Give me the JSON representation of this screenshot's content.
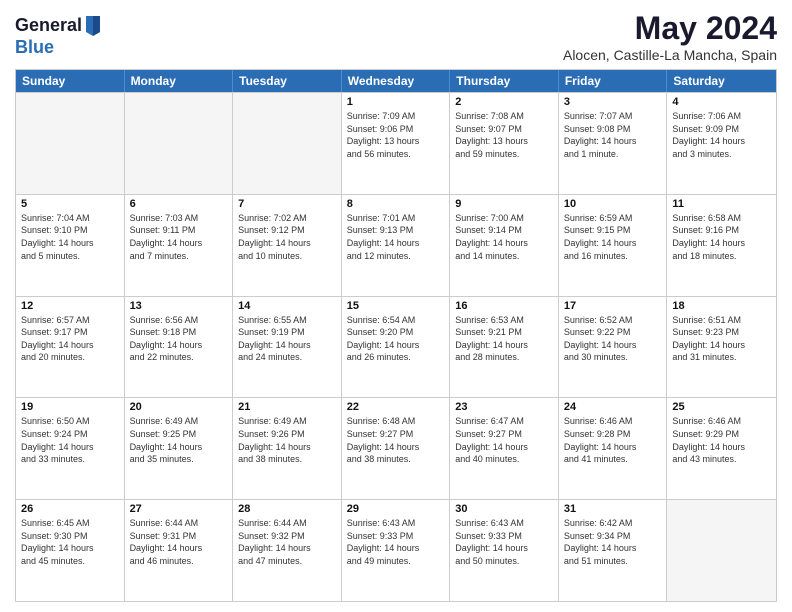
{
  "header": {
    "logo_general": "General",
    "logo_blue": "Blue",
    "title": "May 2024",
    "subtitle": "Alocen, Castille-La Mancha, Spain"
  },
  "days_of_week": [
    "Sunday",
    "Monday",
    "Tuesday",
    "Wednesday",
    "Thursday",
    "Friday",
    "Saturday"
  ],
  "weeks": [
    [
      {
        "day": "",
        "info": ""
      },
      {
        "day": "",
        "info": ""
      },
      {
        "day": "",
        "info": ""
      },
      {
        "day": "1",
        "info": "Sunrise: 7:09 AM\nSunset: 9:06 PM\nDaylight: 13 hours\nand 56 minutes."
      },
      {
        "day": "2",
        "info": "Sunrise: 7:08 AM\nSunset: 9:07 PM\nDaylight: 13 hours\nand 59 minutes."
      },
      {
        "day": "3",
        "info": "Sunrise: 7:07 AM\nSunset: 9:08 PM\nDaylight: 14 hours\nand 1 minute."
      },
      {
        "day": "4",
        "info": "Sunrise: 7:06 AM\nSunset: 9:09 PM\nDaylight: 14 hours\nand 3 minutes."
      }
    ],
    [
      {
        "day": "5",
        "info": "Sunrise: 7:04 AM\nSunset: 9:10 PM\nDaylight: 14 hours\nand 5 minutes."
      },
      {
        "day": "6",
        "info": "Sunrise: 7:03 AM\nSunset: 9:11 PM\nDaylight: 14 hours\nand 7 minutes."
      },
      {
        "day": "7",
        "info": "Sunrise: 7:02 AM\nSunset: 9:12 PM\nDaylight: 14 hours\nand 10 minutes."
      },
      {
        "day": "8",
        "info": "Sunrise: 7:01 AM\nSunset: 9:13 PM\nDaylight: 14 hours\nand 12 minutes."
      },
      {
        "day": "9",
        "info": "Sunrise: 7:00 AM\nSunset: 9:14 PM\nDaylight: 14 hours\nand 14 minutes."
      },
      {
        "day": "10",
        "info": "Sunrise: 6:59 AM\nSunset: 9:15 PM\nDaylight: 14 hours\nand 16 minutes."
      },
      {
        "day": "11",
        "info": "Sunrise: 6:58 AM\nSunset: 9:16 PM\nDaylight: 14 hours\nand 18 minutes."
      }
    ],
    [
      {
        "day": "12",
        "info": "Sunrise: 6:57 AM\nSunset: 9:17 PM\nDaylight: 14 hours\nand 20 minutes."
      },
      {
        "day": "13",
        "info": "Sunrise: 6:56 AM\nSunset: 9:18 PM\nDaylight: 14 hours\nand 22 minutes."
      },
      {
        "day": "14",
        "info": "Sunrise: 6:55 AM\nSunset: 9:19 PM\nDaylight: 14 hours\nand 24 minutes."
      },
      {
        "day": "15",
        "info": "Sunrise: 6:54 AM\nSunset: 9:20 PM\nDaylight: 14 hours\nand 26 minutes."
      },
      {
        "day": "16",
        "info": "Sunrise: 6:53 AM\nSunset: 9:21 PM\nDaylight: 14 hours\nand 28 minutes."
      },
      {
        "day": "17",
        "info": "Sunrise: 6:52 AM\nSunset: 9:22 PM\nDaylight: 14 hours\nand 30 minutes."
      },
      {
        "day": "18",
        "info": "Sunrise: 6:51 AM\nSunset: 9:23 PM\nDaylight: 14 hours\nand 31 minutes."
      }
    ],
    [
      {
        "day": "19",
        "info": "Sunrise: 6:50 AM\nSunset: 9:24 PM\nDaylight: 14 hours\nand 33 minutes."
      },
      {
        "day": "20",
        "info": "Sunrise: 6:49 AM\nSunset: 9:25 PM\nDaylight: 14 hours\nand 35 minutes."
      },
      {
        "day": "21",
        "info": "Sunrise: 6:49 AM\nSunset: 9:26 PM\nDaylight: 14 hours\nand 38 minutes."
      },
      {
        "day": "22",
        "info": "Sunrise: 6:48 AM\nSunset: 9:27 PM\nDaylight: 14 hours\nand 38 minutes."
      },
      {
        "day": "23",
        "info": "Sunrise: 6:47 AM\nSunset: 9:27 PM\nDaylight: 14 hours\nand 40 minutes."
      },
      {
        "day": "24",
        "info": "Sunrise: 6:46 AM\nSunset: 9:28 PM\nDaylight: 14 hours\nand 41 minutes."
      },
      {
        "day": "25",
        "info": "Sunrise: 6:46 AM\nSunset: 9:29 PM\nDaylight: 14 hours\nand 43 minutes."
      }
    ],
    [
      {
        "day": "26",
        "info": "Sunrise: 6:45 AM\nSunset: 9:30 PM\nDaylight: 14 hours\nand 45 minutes."
      },
      {
        "day": "27",
        "info": "Sunrise: 6:44 AM\nSunset: 9:31 PM\nDaylight: 14 hours\nand 46 minutes."
      },
      {
        "day": "28",
        "info": "Sunrise: 6:44 AM\nSunset: 9:32 PM\nDaylight: 14 hours\nand 47 minutes."
      },
      {
        "day": "29",
        "info": "Sunrise: 6:43 AM\nSunset: 9:33 PM\nDaylight: 14 hours\nand 49 minutes."
      },
      {
        "day": "30",
        "info": "Sunrise: 6:43 AM\nSunset: 9:33 PM\nDaylight: 14 hours\nand 50 minutes."
      },
      {
        "day": "31",
        "info": "Sunrise: 6:42 AM\nSunset: 9:34 PM\nDaylight: 14 hours\nand 51 minutes."
      },
      {
        "day": "",
        "info": ""
      }
    ]
  ]
}
